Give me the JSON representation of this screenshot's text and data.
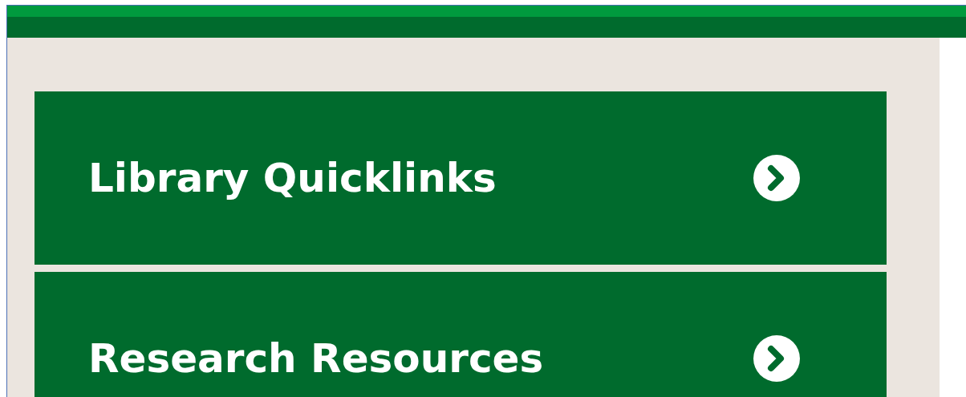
{
  "links": [
    {
      "label": "Library Quicklinks"
    },
    {
      "label": "Research Resources"
    }
  ]
}
